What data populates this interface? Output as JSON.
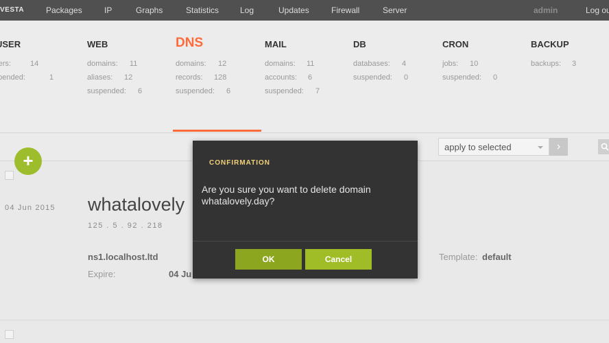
{
  "app": {
    "logo": "VESTA"
  },
  "nav": {
    "items": [
      "Packages",
      "IP",
      "Graphs",
      "Statistics",
      "Log",
      "Updates",
      "Firewall",
      "Server"
    ],
    "user": "admin",
    "logout": "Log out"
  },
  "stats": {
    "user": {
      "title": "USER",
      "rows": [
        {
          "label": "users:",
          "value": "14"
        },
        {
          "label": "suspended:",
          "value": "1"
        }
      ]
    },
    "web": {
      "title": "WEB",
      "rows": [
        {
          "label": "domains:",
          "value": "11"
        },
        {
          "label": "aliases:",
          "value": "12"
        },
        {
          "label": "suspended:",
          "value": "6"
        }
      ]
    },
    "dns": {
      "title": "DNS",
      "rows": [
        {
          "label": "domains:",
          "value": "12"
        },
        {
          "label": "records:",
          "value": "128"
        },
        {
          "label": "suspended:",
          "value": "6"
        }
      ]
    },
    "mail": {
      "title": "MAIL",
      "rows": [
        {
          "label": "domains:",
          "value": "11"
        },
        {
          "label": "accounts:",
          "value": "6"
        },
        {
          "label": "suspended:",
          "value": "7"
        }
      ]
    },
    "db": {
      "title": "DB",
      "rows": [
        {
          "label": "databases:",
          "value": "4"
        },
        {
          "label": "suspended:",
          "value": "0"
        }
      ]
    },
    "cron": {
      "title": "CRON",
      "rows": [
        {
          "label": "jobs:",
          "value": "10"
        },
        {
          "label": "suspended:",
          "value": "0"
        }
      ]
    },
    "backup": {
      "title": "BACKUP",
      "rows": [
        {
          "label": "backups:",
          "value": "3"
        }
      ]
    }
  },
  "toolbar": {
    "add_label": "+",
    "bulk_select": "apply to selected",
    "apply_label": "›"
  },
  "row": {
    "date": "04 Jun 2015",
    "domain": "whatalovely",
    "ip": "125 . 5 . 92 . 218",
    "ns": "ns1.localhost.ltd",
    "expire_label": "Expire:",
    "expire_value": "04 Ju",
    "template_label": "Template:",
    "template_value": "default"
  },
  "modal": {
    "title": "CONFIRMATION",
    "message": "Are you sure you want to delete domain whatalovely.day?",
    "ok": "OK",
    "cancel": "Cancel"
  },
  "colors": {
    "accent": "#ff6a39",
    "green": "#9dbd2c",
    "modal_bg": "#333333",
    "modal_title": "#f2d27a"
  }
}
